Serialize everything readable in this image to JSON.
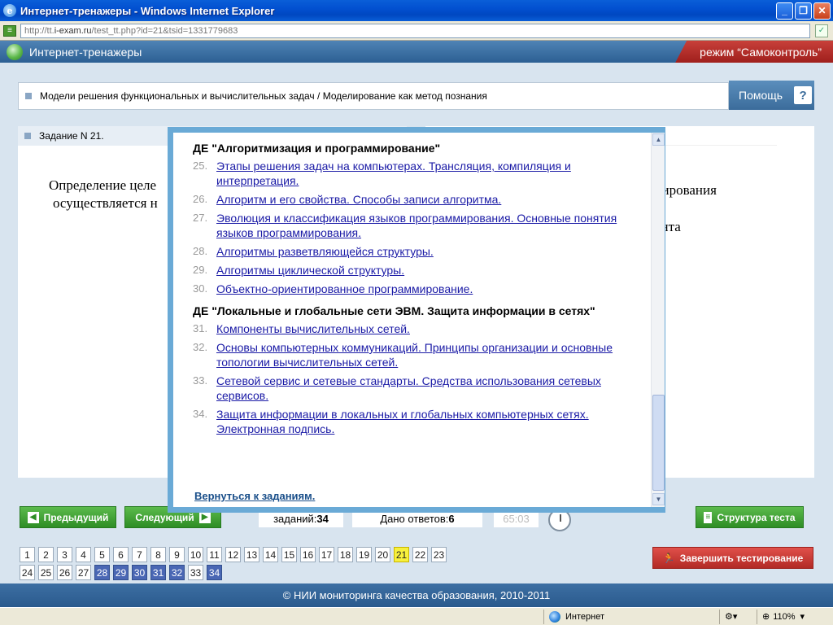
{
  "window": {
    "title": "Интернет-тренажеры - Windows Internet Explorer",
    "url_prefix": "http://tt.",
    "url_host": "i-exam.ru",
    "url_rest": "/test_tt.php?id=21&tsid=1331779683",
    "min": "_",
    "max": "❐",
    "close": "✕"
  },
  "app": {
    "title": "Интернет-тренажеры",
    "mode": "режим “Самоконтроль”"
  },
  "breadcrumb": "Модели решения функциональных и вычислительных задач / Моделирование как метод познания",
  "help": {
    "label": "Помощь",
    "q": "?"
  },
  "task": {
    "header": "Задание N 21.",
    "line1": "Определение целе",
    "line2": "осуществляется н",
    "right1": "лирования",
    "right2": "ента"
  },
  "popup": {
    "sections": [
      {
        "title": "ДЕ \"Алгоритмизация и программирование\"",
        "topics": [
          {
            "num": "25.",
            "text": "Этапы решения задач на компьютерах. Трансляция, компиляция и интерпретация."
          },
          {
            "num": "26.",
            "text": "Алгоритм и его свойства. Способы записи алгоритма."
          },
          {
            "num": "27.",
            "text": "Эволюция и классификация языков программирования. Основные понятия языков программирования."
          },
          {
            "num": "28.",
            "text": "Алгоритмы разветвляющейся структуры."
          },
          {
            "num": "29.",
            "text": "Алгоритмы циклической структуры."
          },
          {
            "num": "30.",
            "text": "Объектно-ориентированное программирование."
          }
        ]
      },
      {
        "title": "ДЕ \"Локальные и глобальные сети ЭВМ. Защита информации в сетях\"",
        "topics": [
          {
            "num": "31.",
            "text": "Компоненты вычислительных сетей."
          },
          {
            "num": "32.",
            "text": "Основы компьютерных коммуникаций. Принципы организации и основные топологии вычислительных сетей."
          },
          {
            "num": "33.",
            "text": "Сетевой сервис и сетевые стандарты. Средства использования сетевых сервисов."
          },
          {
            "num": "34.",
            "text": "Защита информации в локальных и глобальных компьютерных сетях. Электронная подпись."
          }
        ]
      }
    ],
    "back": "Вернуться к заданиям",
    "back_tail": "."
  },
  "nav": {
    "prev": "Предыдущий",
    "next": "Следующий",
    "tasks_label": "заданий: ",
    "tasks_value": "34",
    "answers_label": "Дано ответов: ",
    "answers_value": "6",
    "timer": "65:03",
    "structure": "Структура теста",
    "finish": "Завершить тестирование"
  },
  "question_numbers": {
    "row1": [
      "1",
      "2",
      "3",
      "4",
      "5",
      "6",
      "7",
      "8",
      "9",
      "10",
      "11",
      "12",
      "13",
      "14",
      "15",
      "16",
      "17",
      "18",
      "19",
      "20",
      "21",
      "22",
      "23"
    ],
    "row2": [
      "24",
      "25",
      "26",
      "27",
      "28",
      "29",
      "30",
      "31",
      "32",
      "33",
      "34"
    ],
    "current": "21",
    "answered": [
      "28",
      "29",
      "30",
      "31",
      "32",
      "34"
    ]
  },
  "footer": "© НИИ мониторинга качества образования, 2010-2011",
  "status": {
    "zone": "Интернет",
    "zoom": "110%"
  }
}
